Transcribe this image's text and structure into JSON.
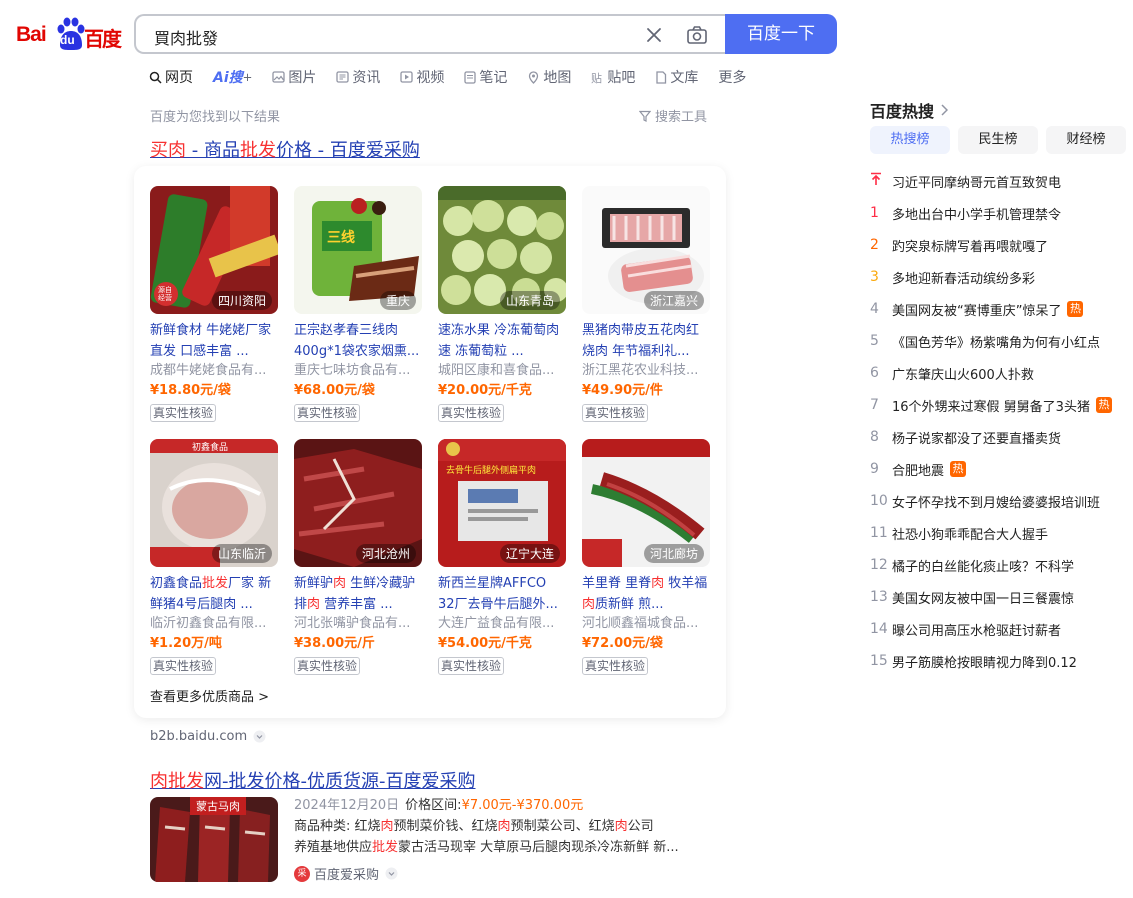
{
  "logo": {
    "bai": "Bai",
    "du": "du",
    "cn": "百度"
  },
  "search": {
    "query": "買肉批發",
    "button": "百度一下"
  },
  "tabs": [
    {
      "label": "网页"
    },
    {
      "label": "Ai搜"
    },
    {
      "label": "图片"
    },
    {
      "label": "资讯"
    },
    {
      "label": "视频"
    },
    {
      "label": "笔记"
    },
    {
      "label": "地图"
    },
    {
      "label": "贴吧"
    },
    {
      "label": "文库"
    },
    {
      "label": "更多"
    }
  ],
  "result_count": "百度为您找到以下结果",
  "search_tools": "搜索工具",
  "result1": {
    "title_hl1": "买肉",
    "title_mid1": " - 商品",
    "title_hl2": "批发",
    "title_mid2": "价格 - 百度爱采购",
    "products": [
      {
        "location": "四川资阳",
        "desc": "新鲜食材 牛姥姥厂家直发 口感丰富 ...",
        "company": "成都牛姥姥食品有...",
        "price": "¥18.80元/袋",
        "badge": "真实性核验"
      },
      {
        "location": "重庆",
        "desc": "正宗赵孝春三线肉400g*1袋农家烟熏...",
        "company": "重庆七味坊食品有...",
        "price": "¥68.00元/袋",
        "badge": "真实性核验"
      },
      {
        "location": "山东青岛",
        "desc": "速冻水果 冷冻葡萄肉速 冻葡萄粒 ...",
        "company": "城阳区康和喜食品...",
        "price": "¥20.00元/千克",
        "badge": "真实性核验"
      },
      {
        "location": "浙江嘉兴",
        "desc": "黑猪肉带皮五花肉红烧肉 年节福利礼...",
        "company": "浙江黑花农业科技...",
        "price": "¥49.90元/件",
        "badge": "真实性核验"
      },
      {
        "location": "山东临沂",
        "desc": "初鑫食品批发厂家 新鲜猪4号后腿肉 ...",
        "company": "临沂初鑫食品有限...",
        "price": "¥1.20万/吨",
        "badge": "真实性核验"
      },
      {
        "location": "河北沧州",
        "desc": "新鲜驴肉 生鲜冷藏驴排肉 营养丰富 ...",
        "company": "河北张嘴驴食品有...",
        "price": "¥38.00元/斤",
        "badge": "真实性核验"
      },
      {
        "location": "辽宁大连",
        "desc": "新西兰星牌AFFCO 32厂去骨牛后腿外...",
        "company": "大连广益食品有限...",
        "price": "¥54.00元/千克",
        "badge": "真实性核验"
      },
      {
        "location": "河北廊坊",
        "desc": "羊里脊 里脊肉 牧羊福肉质新鲜 煎...",
        "company": "河北顺鑫福城食品...",
        "price": "¥72.00元/袋",
        "badge": "真实性核验"
      }
    ],
    "see_more": "查看更多优质商品 >",
    "url": "b2b.baidu.com"
  },
  "result2": {
    "title_hl": "肉批发",
    "title_rest": "网-批发价格-优质货源-百度爱采购",
    "img_tag": "蒙古马肉",
    "date": "2024年12月20日",
    "price_label": "价格区间:",
    "price": "¥7.00元-¥370.00元",
    "line2": "商品种类: 红烧肉预制菜价钱、红烧肉预制菜公司、红烧肉公司",
    "line3": "养殖基地供应批发蒙古活马现宰 大草原马后腿肉现杀冷冻新鲜 新...",
    "source": "百度爱采购"
  },
  "hot": {
    "title": "百度热搜",
    "tabs": [
      "热搜榜",
      "民生榜",
      "财经榜"
    ],
    "items": [
      {
        "rank": "",
        "text": "习近平同摩纳哥元首互致贺电",
        "badge": ""
      },
      {
        "rank": "1",
        "text": "多地出台中小学手机管理禁令",
        "badge": ""
      },
      {
        "rank": "2",
        "text": "趵突泉标牌写着再喂就嘎了",
        "badge": ""
      },
      {
        "rank": "3",
        "text": "多地迎新春活动缤纷多彩",
        "badge": ""
      },
      {
        "rank": "4",
        "text": "美国网友被“赛博重庆”惊呆了",
        "badge": "热"
      },
      {
        "rank": "5",
        "text": "《国色芳华》杨紫嘴角为何有小红点",
        "badge": ""
      },
      {
        "rank": "6",
        "text": "广东肇庆山火600人扑救",
        "badge": ""
      },
      {
        "rank": "7",
        "text": "16个外甥来过寒假 舅舅备了3头猪",
        "badge": "热"
      },
      {
        "rank": "8",
        "text": "杨子说家都没了还要直播卖货",
        "badge": ""
      },
      {
        "rank": "9",
        "text": "合肥地震",
        "badge": "热"
      },
      {
        "rank": "10",
        "text": "女子怀孕找不到月嫂给婆婆报培训班",
        "badge": ""
      },
      {
        "rank": "11",
        "text": "社恐小狗乖乖配合大人握手",
        "badge": ""
      },
      {
        "rank": "12",
        "text": "橘子的白丝能化痰止咳？不科学",
        "badge": ""
      },
      {
        "rank": "13",
        "text": "美国女网友被中国一日三餐震惊",
        "badge": ""
      },
      {
        "rank": "14",
        "text": "曝公司用高压水枪驱赶讨薪者",
        "badge": ""
      },
      {
        "rank": "15",
        "text": "男子筋膜枪按眼睛视力降到0.12",
        "badge": ""
      }
    ]
  },
  "colors": {
    "accent": "#4e6ef2",
    "link": "#2440b3",
    "highlight": "#f73131",
    "price": "#ff6600"
  }
}
